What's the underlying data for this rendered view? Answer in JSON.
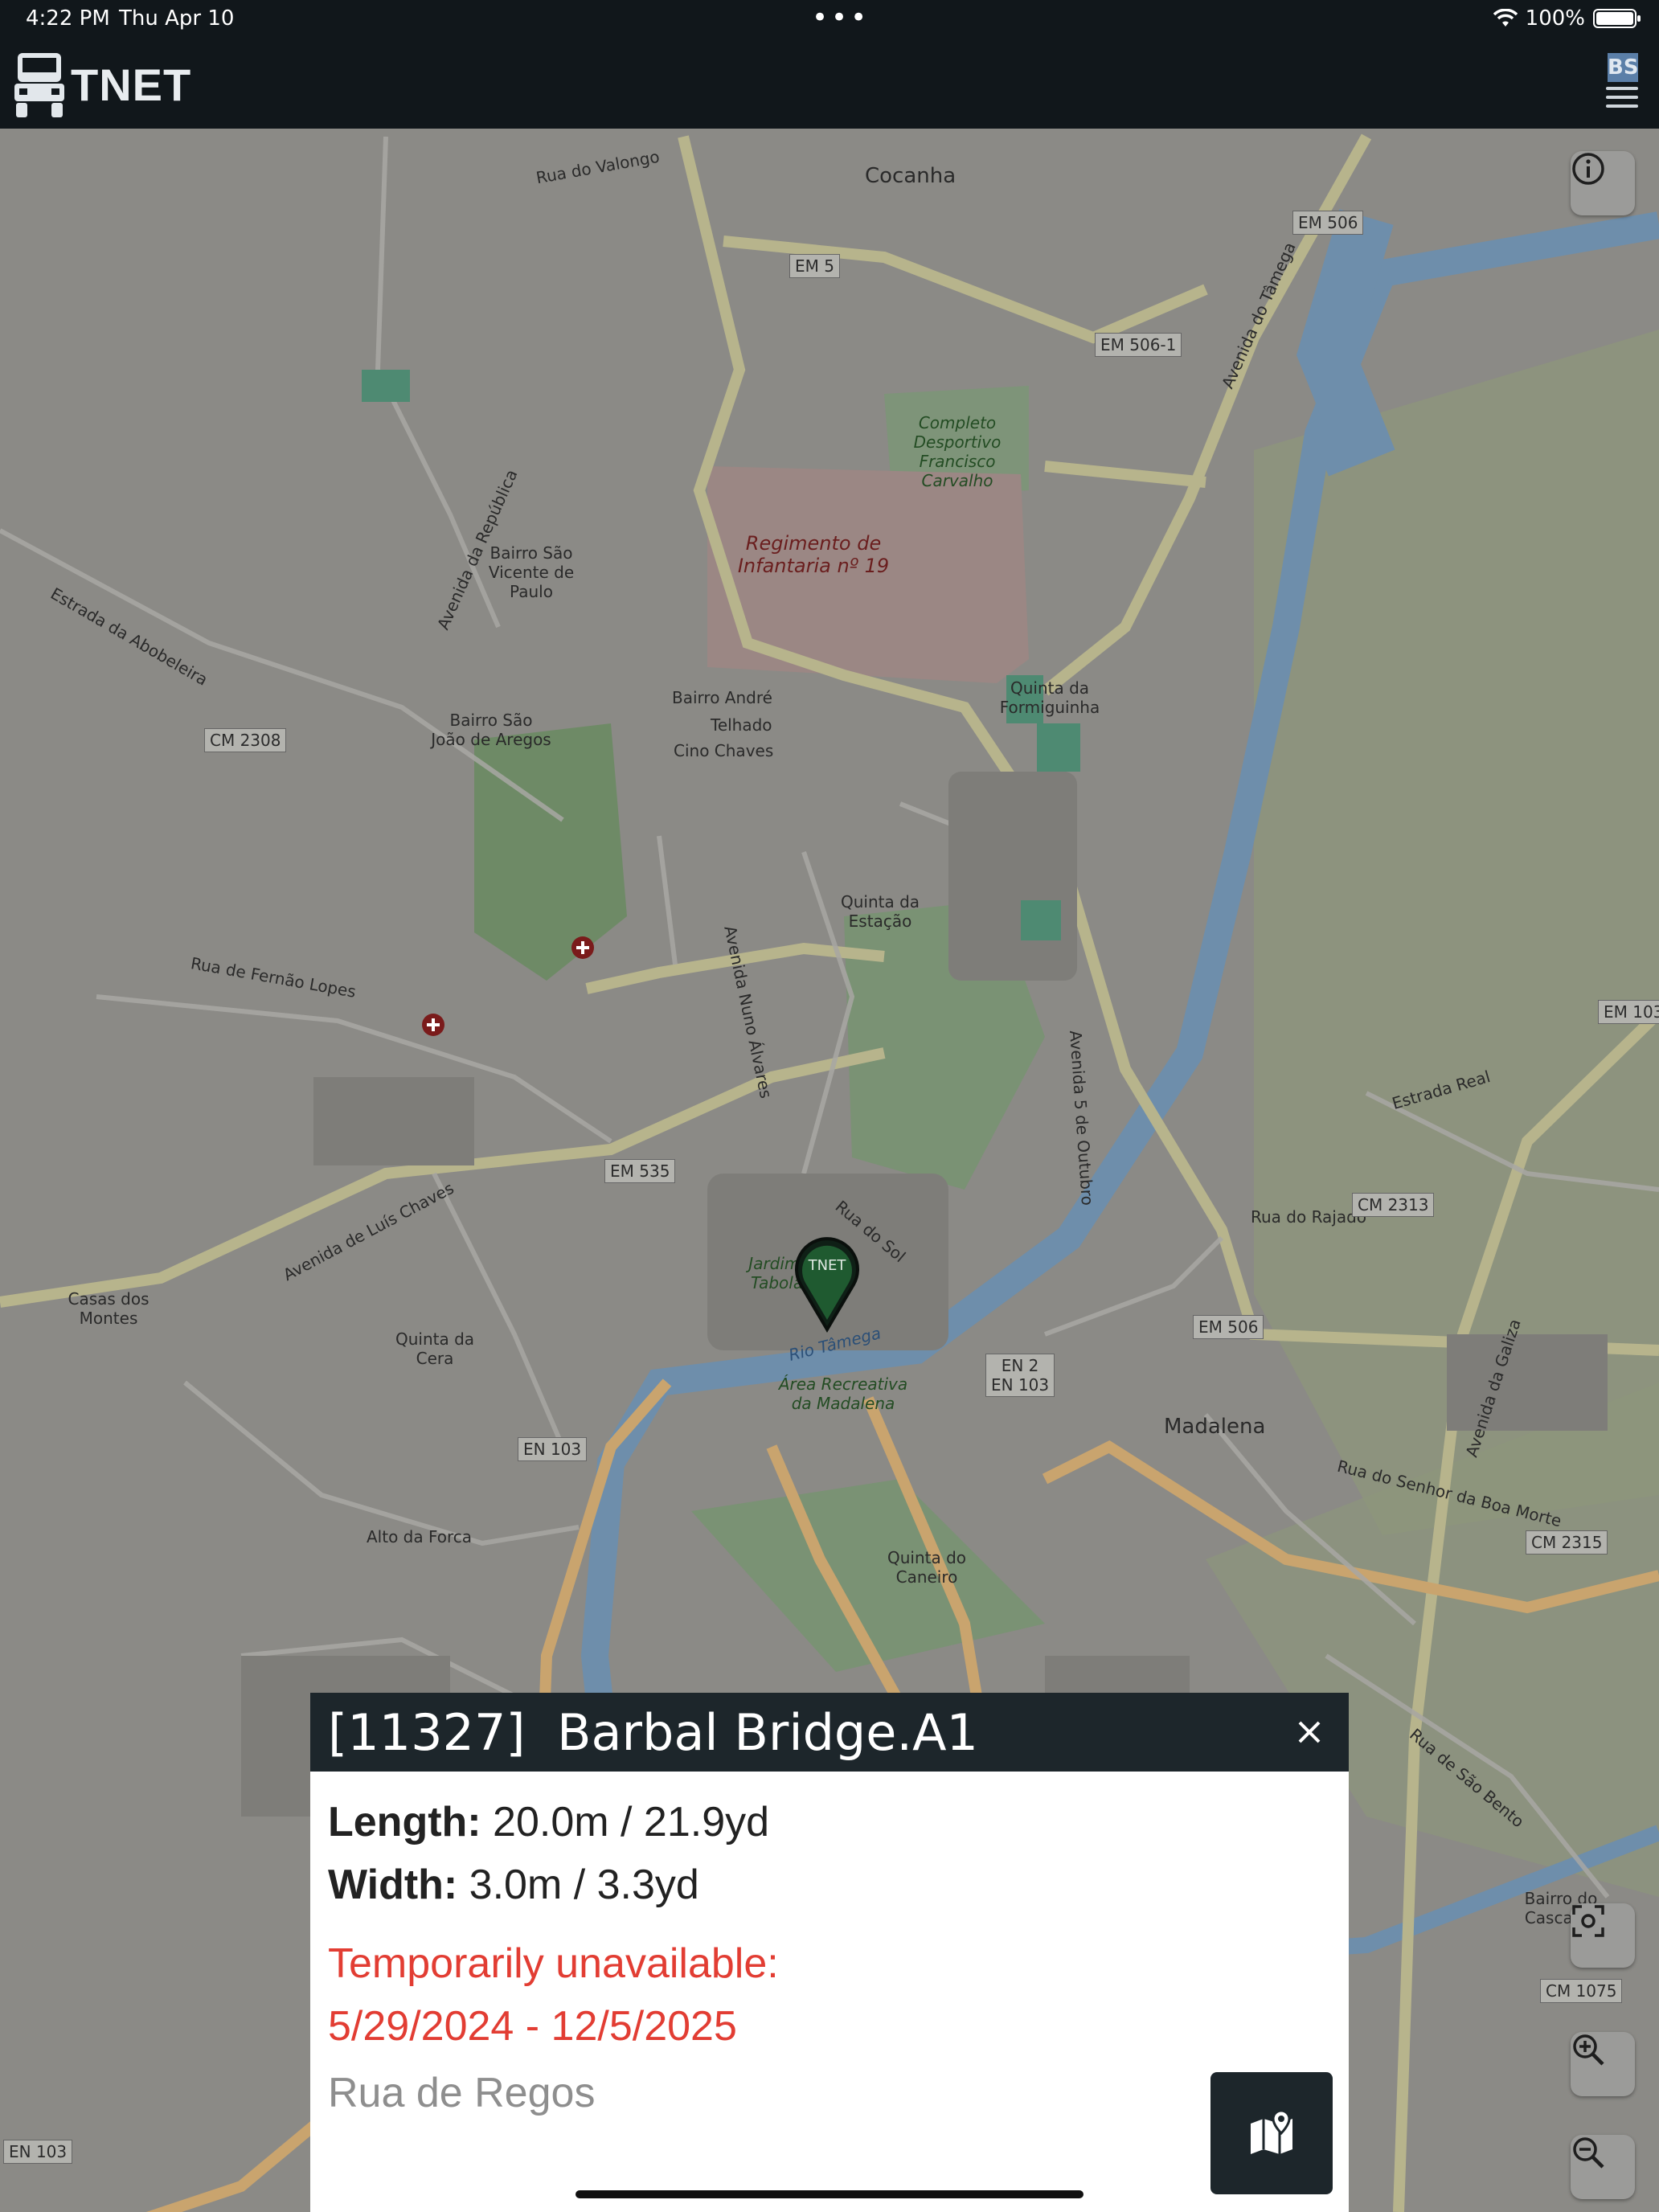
{
  "status_bar": {
    "time": "4:22 PM",
    "date": "Thu Apr 10",
    "battery": "100%"
  },
  "app": {
    "name": "TNET",
    "badge": "BS"
  },
  "map": {
    "marker_label": "TNET",
    "labels": {
      "cocanha": "Cocanha",
      "regimento": "Regimento de Infantaria nº 19",
      "desportivo": "Completo Desportivo Francisco Carvalho",
      "bairro_sao_vicente": "Bairro São Vicente de Paulo",
      "bairro_sao_joao": "Bairro São João de Aregos",
      "bairro_andre": "Bairro André",
      "telhado": "Telhado",
      "cino_chaves": "Cino Chaves",
      "quinta_formiguinha": "Quinta da Formiguinha",
      "quinta_estacao": "Quinta da Estação",
      "jardim": "Jardim do Tabolado",
      "area_recreativa": "Área Recreativa da Madalena",
      "madalena": "Madalena",
      "casas_montes": "Casas dos Montes",
      "quinta_cera": "Quinta da Cera",
      "alto_forca": "Alto da Forca",
      "quinta_caneiro": "Quinta do Caneiro",
      "bairro_cascalho": "Bairro do Cascalho",
      "rio_tamega": "Rio Tâmega",
      "rua_regos": "Rua do Sol",
      "rua_rajado": "Rua do Rajado",
      "rua_valongo": "Rua do Valongo",
      "estrada_real": "Estrada Real",
      "av_luis_chaves": "Avenida de Luís Chaves",
      "av_nuno_alvares": "Avenida Nuno Álvares",
      "av_republica": "Avenida da República",
      "av_tamega": "Avenida do Tâmega",
      "av_5_outubro": "Avenida 5 de Outubro",
      "av_galiza": "Avenida da Galiza",
      "rua_senhor_boa_morte": "Rua do Senhor da Boa Morte",
      "rua_fernao_lopes": "Rua de Fernão Lopes",
      "estrada_abobeleira": "Estrada da Abobeleira",
      "rua_sao_bento": "Rua de São Bento"
    },
    "shields": {
      "em506": "EM 506",
      "em5061": "EM 506-1",
      "cm2308": "CM 2308",
      "em535": "EM 535",
      "en103": "EN 103",
      "en2": "EN 2\nEN 103",
      "em506b": "EM 506",
      "cm2313": "CM 2313",
      "cm2315": "CM 2315",
      "em103": "EM 103",
      "cm1075": "CM 1075",
      "en103b": "EN 103",
      "em5": "EM 5"
    }
  },
  "popup": {
    "title": "[11327]  Barbal Bridge.A1",
    "length_label": "Length:",
    "length_value": " 20.0m / 21.9yd",
    "width_label": "Width:",
    "width_value": " 3.0m / 3.3yd",
    "warning_line1": "Temporarily unavailable:",
    "warning_line2": "5/29/2024 - 12/5/2025",
    "street": "Rua de Regos"
  }
}
